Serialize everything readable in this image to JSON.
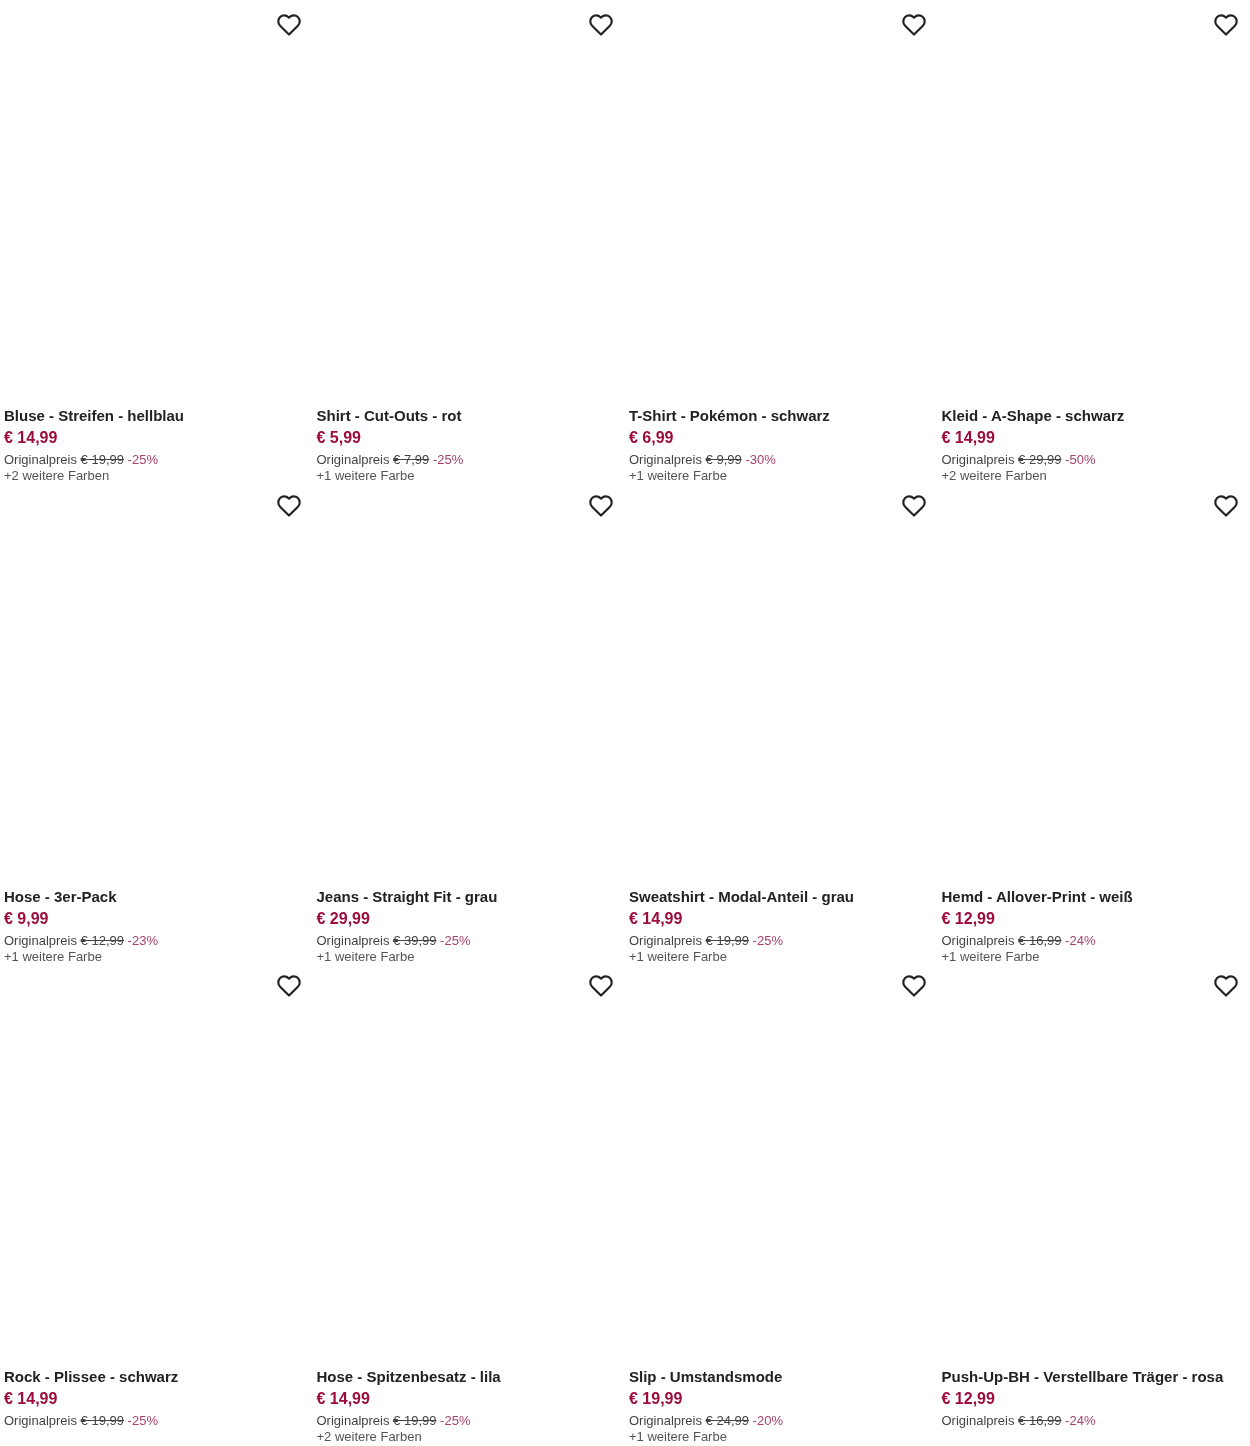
{
  "products": [
    {
      "title": "Bluse - Streifen - hellblau",
      "price": "€ 14,99",
      "original_label": "Originalpreis",
      "original_price": "€ 19,99",
      "discount": "-25%",
      "more_colors": "+2 weitere Farben",
      "favorite": false
    },
    {
      "title": "Shirt - Cut-Outs - rot",
      "price": "€ 5,99",
      "original_label": "Originalpreis",
      "original_price": "€ 7,99",
      "discount": "-25%",
      "more_colors": "+1 weitere Farbe",
      "favorite": false
    },
    {
      "title": "T-Shirt - Pokémon - schwarz",
      "price": "€ 6,99",
      "original_label": "Originalpreis",
      "original_price": "€ 9,99",
      "discount": "-30%",
      "more_colors": "+1 weitere Farbe",
      "favorite": false
    },
    {
      "title": "Kleid - A-Shape - schwarz",
      "price": "€ 14,99",
      "original_label": "Originalpreis",
      "original_price": "€ 29,99",
      "discount": "-50%",
      "more_colors": "+2 weitere Farben",
      "favorite": false
    },
    {
      "title": "Hose - 3er-Pack",
      "price": "€ 9,99",
      "original_label": "Originalpreis",
      "original_price": "€ 12,99",
      "discount": "-23%",
      "more_colors": "+1 weitere Farbe",
      "favorite": false
    },
    {
      "title": "Jeans - Straight Fit - grau",
      "price": "€ 29,99",
      "original_label": "Originalpreis",
      "original_price": "€ 39,99",
      "discount": "-25%",
      "more_colors": "+1 weitere Farbe",
      "favorite": false
    },
    {
      "title": "Sweatshirt - Modal-Anteil - grau",
      "price": "€ 14,99",
      "original_label": "Originalpreis",
      "original_price": "€ 19,99",
      "discount": "-25%",
      "more_colors": "+1 weitere Farbe",
      "favorite": false
    },
    {
      "title": "Hemd - Allover-Print - weiß",
      "price": "€ 12,99",
      "original_label": "Originalpreis",
      "original_price": "€ 16,99",
      "discount": "-24%",
      "more_colors": "+1 weitere Farbe",
      "favorite": false
    },
    {
      "title": "Rock - Plissee - schwarz",
      "price": "€ 14,99",
      "original_label": "Originalpreis",
      "original_price": "€ 19,99",
      "discount": "-25%",
      "favorite": false
    },
    {
      "title": "Hose - Spitzenbesatz - lila",
      "price": "€ 14,99",
      "original_label": "Originalpreis",
      "original_price": "€ 19,99",
      "discount": "-25%",
      "more_colors": "+2 weitere Farben",
      "favorite": false
    },
    {
      "title": "Slip - Umstandsmode",
      "price": "€ 19,99",
      "original_label": "Originalpreis",
      "original_price": "€ 24,99",
      "discount": "-20%",
      "more_colors": "+1 weitere Farbe",
      "favorite": false
    },
    {
      "title": "Push-Up-BH - Verstellbare Träger - rosa",
      "price": "€ 12,99",
      "original_label": "Originalpreis",
      "original_price": "€ 16,99",
      "discount": "-24%",
      "favorite": false
    }
  ]
}
